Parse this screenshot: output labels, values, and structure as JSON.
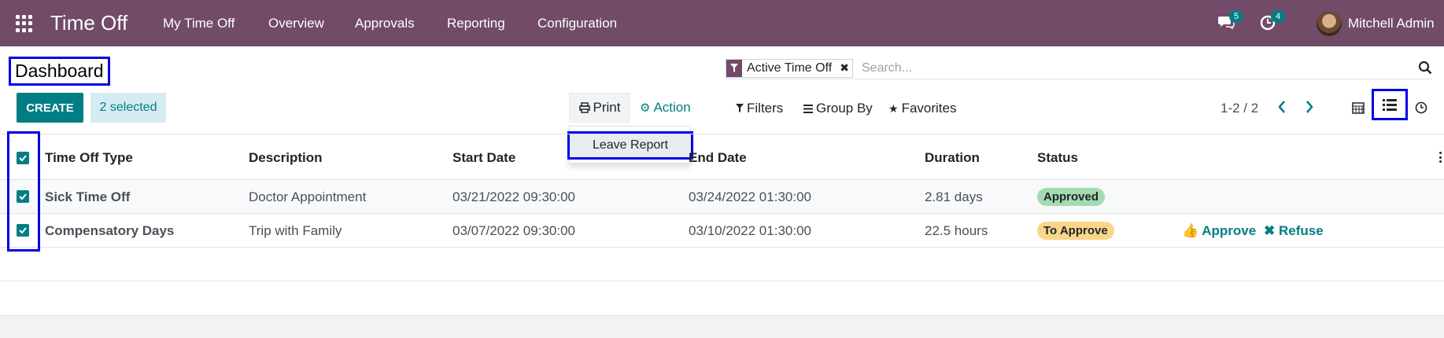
{
  "navbar": {
    "app_title": "Time Off",
    "menus": [
      "My Time Off",
      "Overview",
      "Approvals",
      "Reporting",
      "Configuration"
    ],
    "messages_count": "5",
    "activities_count": "4",
    "user_name": "Mitchell Admin",
    "color": "#714b67"
  },
  "page": {
    "title": "Dashboard"
  },
  "search": {
    "facet_label": "Active Time Off",
    "placeholder": "Search..."
  },
  "toolbar": {
    "create_label": "CREATE",
    "selected_label": "2 selected",
    "print_label": "Print",
    "action_label": "Action",
    "print_menu": [
      "Leave Report"
    ],
    "filters_label": "Filters",
    "groupby_label": "Group By",
    "favorites_label": "Favorites",
    "pager": "1-2 / 2",
    "accent": "#017e84"
  },
  "table": {
    "columns": [
      "Time Off Type",
      "Description",
      "Start Date",
      "End Date",
      "Duration",
      "Status"
    ],
    "rows": [
      {
        "type": "Sick Time Off",
        "description": "Doctor Appointment",
        "start": "03/21/2022 09:30:00",
        "end": "03/24/2022 01:30:00",
        "duration": "2.81 days",
        "status": "Approved",
        "status_color": "#a3dbb1"
      },
      {
        "type": "Compensatory Days",
        "description": "Trip with Family",
        "start": "03/07/2022 09:30:00",
        "end": "03/10/2022 01:30:00",
        "duration": "22.5 hours",
        "status": "To Approve",
        "status_color": "#fbd68a",
        "approve_label": "Approve",
        "refuse_label": "Refuse"
      }
    ]
  }
}
